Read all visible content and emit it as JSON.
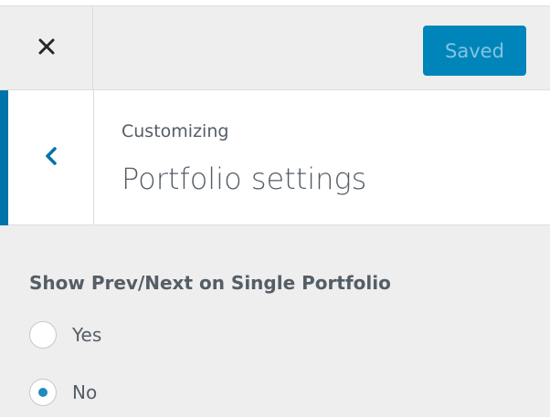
{
  "header": {
    "close_icon": "close-icon",
    "save_button_label": "Saved",
    "colors": {
      "save_button_bg": "#0085ba",
      "save_button_text": "#83c4e0"
    }
  },
  "section": {
    "back_icon": "chevron-left-icon",
    "overline": "Customizing",
    "title": "Portfolio settings",
    "accent_color": "#0073aa"
  },
  "control": {
    "label": "Show Prev/Next on Single Portfolio",
    "options": [
      {
        "label": "Yes",
        "checked": false
      },
      {
        "label": "No",
        "checked": true
      }
    ],
    "selected": "No"
  }
}
